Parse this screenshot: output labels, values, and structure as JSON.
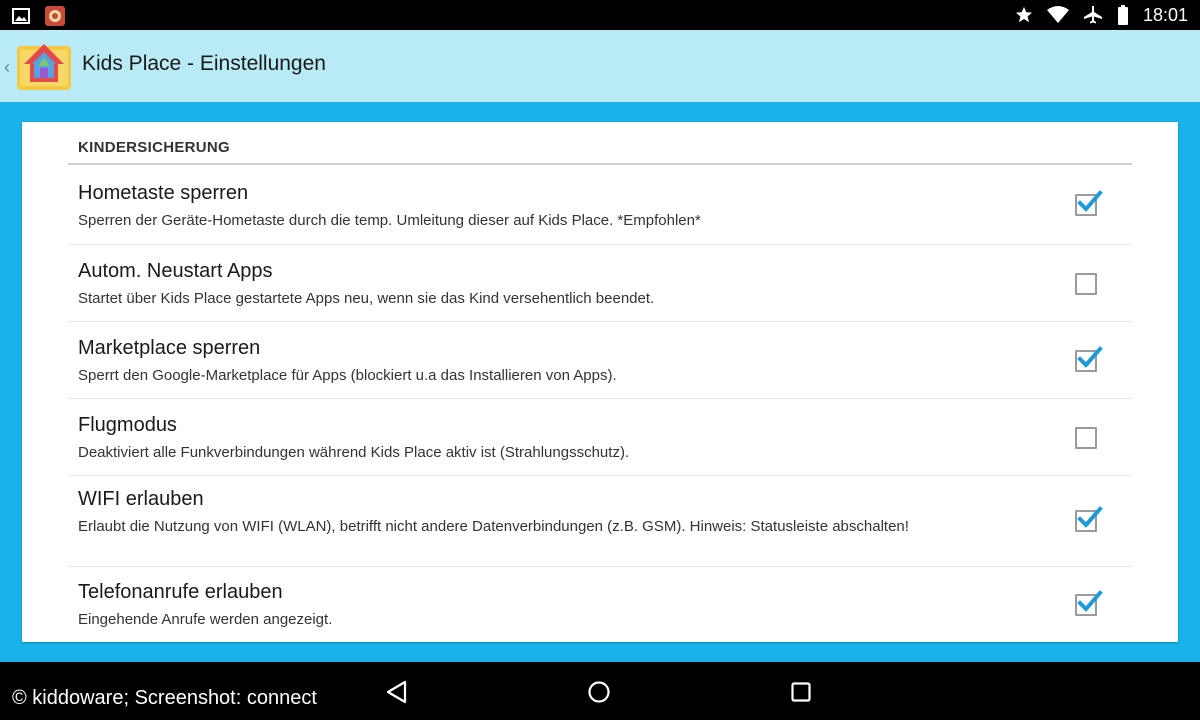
{
  "status_bar": {
    "left_icons": [
      "gallery-icon",
      "notification-app-icon"
    ],
    "right_icons": [
      "star-icon",
      "wifi-icon",
      "airplane-icon",
      "battery-icon"
    ],
    "time": "18:01"
  },
  "action_bar": {
    "title": "Kids Place - Einstellungen",
    "background": "#b9ebf7"
  },
  "settings": {
    "section_header": "KINDERSICHERUNG",
    "items": [
      {
        "title": "Hometaste sperren",
        "subtitle": "Sperren der Geräte-Hometaste durch die temp. Umleitung dieser auf Kids Place. *Empfohlen*",
        "checked": true
      },
      {
        "title": "Autom. Neustart Apps",
        "subtitle": "Startet über Kids Place gestartete Apps neu, wenn sie das Kind versehentlich beendet.",
        "checked": false
      },
      {
        "title": "Marketplace sperren",
        "subtitle": "Sperrt den Google-Marketplace für Apps (blockiert u.a das Installieren von Apps).",
        "checked": true
      },
      {
        "title": "Flugmodus",
        "subtitle": "Deaktiviert alle Funkverbindungen während Kids Place aktiv ist (Strahlungsschutz).",
        "checked": false
      },
      {
        "title": "WIFI erlauben",
        "subtitle": "Erlaubt die Nutzung von WIFI (WLAN), betrifft nicht andere Datenverbindungen (z.B. GSM). Hinweis: Statusleiste abschalten!",
        "checked": true
      },
      {
        "title": "Telefonanrufe erlauben",
        "subtitle": "Eingehende Anrufe werden angezeigt.",
        "checked": true
      }
    ]
  },
  "nav_bar": {
    "credit": "© kiddoware; Screenshot: connect",
    "buttons": [
      "back-icon",
      "home-icon",
      "recents-icon"
    ]
  },
  "colors": {
    "content_background": "#19b2e8",
    "check_color": "#1e9bd7"
  }
}
